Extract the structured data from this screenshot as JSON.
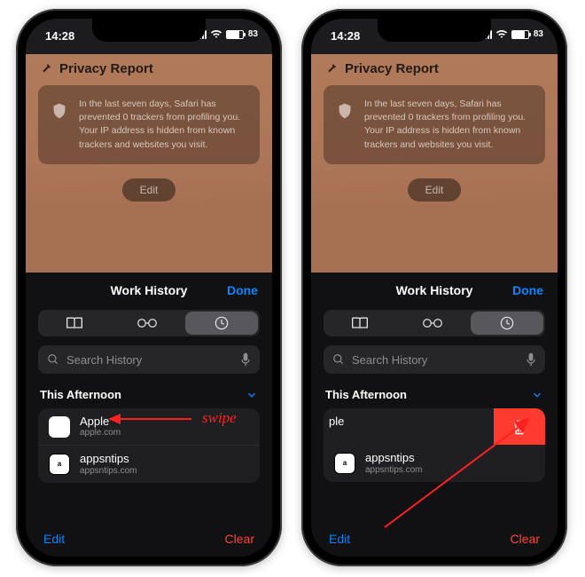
{
  "status": {
    "time": "14:28",
    "battery_pct": 83
  },
  "privacy": {
    "title": "Privacy Report",
    "body": "In the last seven days, Safari has prevented 0 trackers from profiling you. Your IP address is hidden from known trackers and websites you visit.",
    "edit": "Edit"
  },
  "sheet": {
    "title": "Work History",
    "done": "Done",
    "search_placeholder": "Search History",
    "section": "This Afternoon",
    "items": [
      {
        "title": "Apple",
        "sub": "apple.com"
      },
      {
        "title": "appsntips",
        "sub": "appsntips.com"
      }
    ],
    "swiped_fragment": "ple",
    "edit": "Edit",
    "clear": "Clear"
  },
  "annot": {
    "swipe": "swipe"
  }
}
